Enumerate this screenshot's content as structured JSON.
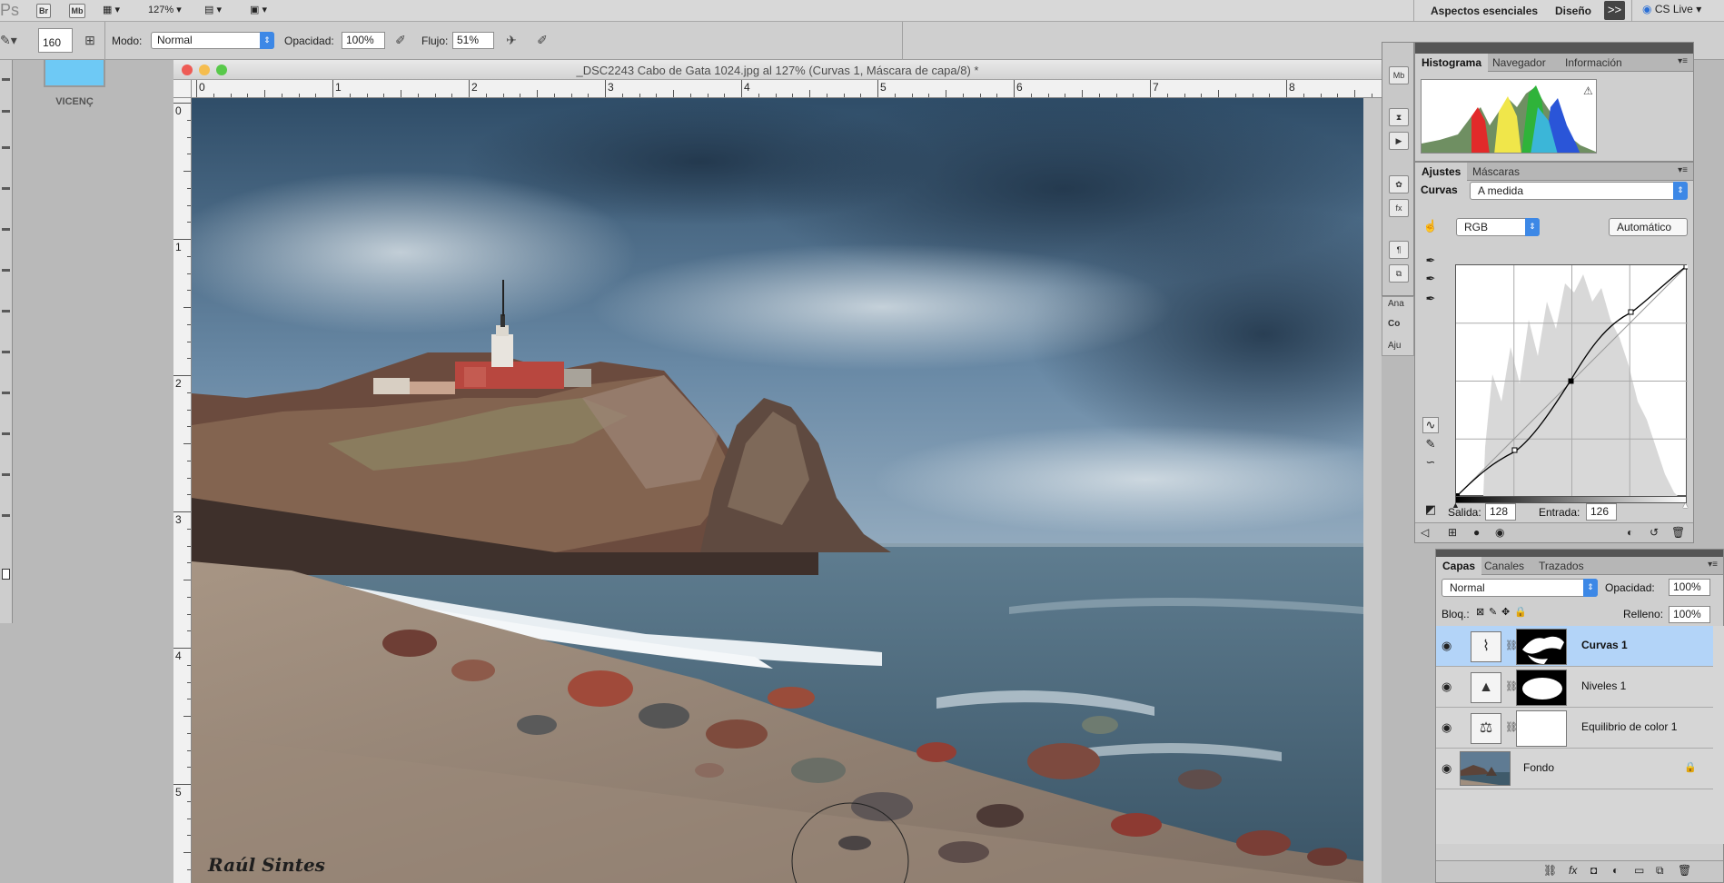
{
  "appbar": {
    "app_label": "Ps",
    "br_label": "Br",
    "mb_label": "Mb",
    "zoom": "127%",
    "workspace": "Aspectos esenciales",
    "design": "Diseño",
    "more_label": ">>",
    "cslive": "CS Live"
  },
  "options": {
    "brush_size": "160",
    "mode_label": "Modo:",
    "mode_value": "Normal",
    "opacity_label": "Opacidad:",
    "opacity_value": "100%",
    "flow_label": "Flujo:",
    "flow_value": "51%"
  },
  "swatch": {
    "name": "VICENÇ",
    "color": "#6ec9f5"
  },
  "document": {
    "title": "_DSC2243 Cabo de Gata 1024.jpg al 127% (Curvas 1, Máscara de capa/8) *",
    "ruler_h": [
      "0",
      "1",
      "2",
      "3",
      "4",
      "5",
      "6",
      "7",
      "8"
    ],
    "ruler_v": [
      "0",
      "1",
      "2",
      "3",
      "4",
      "5"
    ],
    "signature": "Raúl Sintes"
  },
  "histogram_panel": {
    "tabs": [
      "Histograma",
      "Navegador",
      "Información"
    ]
  },
  "adjustments": {
    "tabs": [
      "Ajustes",
      "Máscaras"
    ],
    "type_label": "Curvas",
    "preset": "A medida",
    "channel": "RGB",
    "auto_button": "Automático",
    "output_label": "Salida:",
    "output_value": "128",
    "input_label": "Entrada:",
    "input_value": "126"
  },
  "collapsed": {
    "a": "Ana",
    "b": "Co",
    "c": "Aju"
  },
  "layers": {
    "tabs": [
      "Capas",
      "Canales",
      "Trazados"
    ],
    "blend": "Normal",
    "opacity_label": "Opacidad:",
    "opacity_value": "100%",
    "lock_label": "Bloq.:",
    "fill_label": "Relleno:",
    "fill_value": "100%",
    "items": [
      {
        "name": "Curvas 1"
      },
      {
        "name": "Niveles 1"
      },
      {
        "name": "Equilibrio de color 1"
      },
      {
        "name": "Fondo"
      }
    ]
  }
}
